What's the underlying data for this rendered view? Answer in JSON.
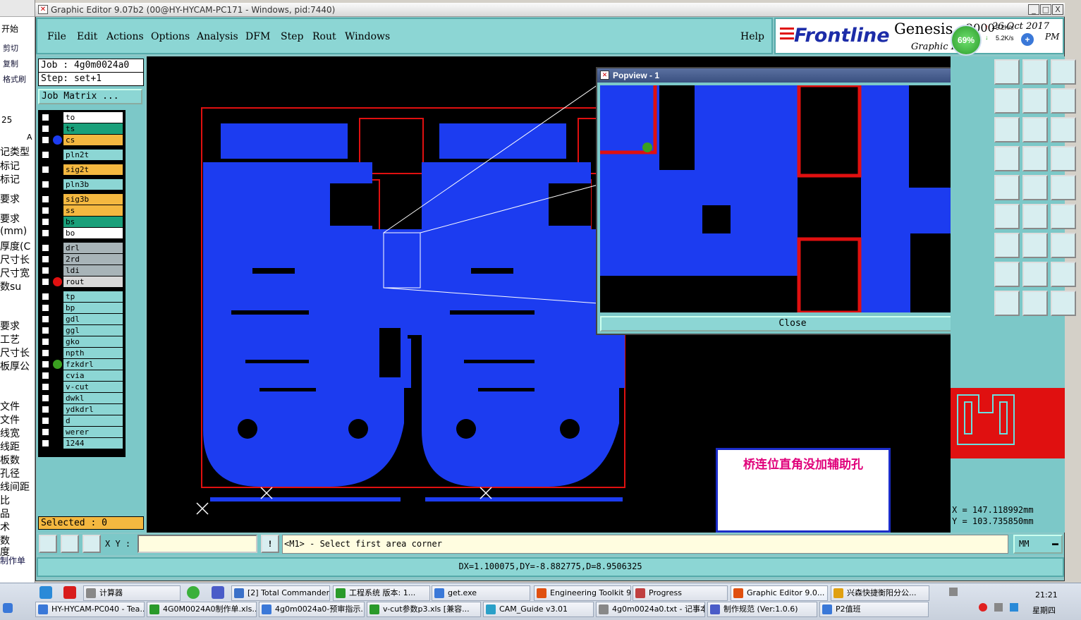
{
  "left_strip": {
    "items": [
      "开始",
      "剪切",
      "复制",
      "格式刷",
      "25",
      "记类型",
      "标记",
      "标记",
      "要求",
      "要求",
      "(mm)",
      "厚度(C",
      "尺寸长",
      "尺寸宽",
      "数su",
      "要求",
      "工艺",
      "尺寸长",
      "板厚公",
      "文件",
      "文件",
      "线宽",
      "线距",
      "板数",
      "孔径",
      "线间距",
      "比",
      "品",
      "术",
      "数",
      "度",
      "制作单"
    ],
    "a_label": "A"
  },
  "window": {
    "title": "Graphic Editor 9.07b2 (00@HY-HYCAM-PC171 - Windows, pid:7440)",
    "min": "_",
    "max": "□",
    "close": "X"
  },
  "menu": {
    "items": [
      "File",
      "Edit",
      "Actions",
      "Options",
      "Analysis",
      "DFM",
      "Step",
      "Rout",
      "Windows"
    ],
    "help": "Help"
  },
  "brand": {
    "logo": "Frontline",
    "product": "Genesis",
    "product_num": "2000",
    "subtitle": "Graphic E",
    "date": "26 Oct 2017",
    "time_suffix": "PM",
    "cpu": "69%",
    "up_speed": "5.2K/s",
    "down_speed": "5.2K/s"
  },
  "job": {
    "job_label": "Job : 4g0m0024a0",
    "step_label": "Step: set+1",
    "matrix_button": "Job Matrix ...",
    "selected": "Selected : 0"
  },
  "layers": [
    {
      "name": "to",
      "color": "#ffffff",
      "dot": ""
    },
    {
      "name": "ts",
      "color": "#1aa07a",
      "dot": ""
    },
    {
      "name": "cs",
      "color": "#f4b840",
      "dot": "#1c3cf0"
    },
    {
      "name": "pln2t",
      "color": "#8cd6d4",
      "dot": ""
    },
    {
      "name": "sig2t",
      "color": "#f4b840",
      "dot": ""
    },
    {
      "name": "pln3b",
      "color": "#8cd6d4",
      "dot": ""
    },
    {
      "name": "sig3b",
      "color": "#f4b840",
      "dot": ""
    },
    {
      "name": "ss",
      "color": "#f4b840",
      "dot": ""
    },
    {
      "name": "bs",
      "color": "#1aa07a",
      "dot": ""
    },
    {
      "name": "bo",
      "color": "#ffffff",
      "dot": ""
    },
    {
      "name": "drl",
      "color": "#a8b4b8",
      "dot": ""
    },
    {
      "name": "2rd",
      "color": "#a8b4b8",
      "dot": ""
    },
    {
      "name": "ldi",
      "color": "#a8b4b8",
      "dot": ""
    },
    {
      "name": "rout",
      "color": "#d8d8d8",
      "dot": "#e01010"
    },
    {
      "name": "tp",
      "color": "#8cd6d4",
      "dot": ""
    },
    {
      "name": "bp",
      "color": "#8cd6d4",
      "dot": ""
    },
    {
      "name": "gdl",
      "color": "#8cd6d4",
      "dot": ""
    },
    {
      "name": "ggl",
      "color": "#8cd6d4",
      "dot": ""
    },
    {
      "name": "gko",
      "color": "#8cd6d4",
      "dot": ""
    },
    {
      "name": "npth",
      "color": "#8cd6d4",
      "dot": ""
    },
    {
      "name": "fzkdrl",
      "color": "#8cd6d4",
      "dot": "#3aa020"
    },
    {
      "name": "cvia",
      "color": "#8cd6d4",
      "dot": ""
    },
    {
      "name": "v-cut",
      "color": "#8cd6d4",
      "dot": ""
    },
    {
      "name": "dwkl",
      "color": "#8cd6d4",
      "dot": ""
    },
    {
      "name": "ydkdrl",
      "color": "#8cd6d4",
      "dot": ""
    },
    {
      "name": "d",
      "color": "#8cd6d4",
      "dot": ""
    },
    {
      "name": "werer",
      "color": "#8cd6d4",
      "dot": ""
    },
    {
      "name": "1244",
      "color": "#8cd6d4",
      "dot": ""
    }
  ],
  "popview": {
    "title": "Popview - 1",
    "close_button": "Close",
    "close_x": "X"
  },
  "note": "桥连位直角没加辅助孔",
  "readout": {
    "x": "X  =  147.118992mm",
    "y": "Y  =  103.735850mm"
  },
  "status": {
    "xy_label": "X Y :",
    "message": "<M1> - Select first area corner",
    "units": "MM",
    "delta": "DX=1.100075,DY=-8.882775,D=8.9506325"
  },
  "taskbar": {
    "row1": [
      "计算器",
      "",
      "[2] Total Commander...",
      "工程系统  版本: 1...",
      "get.exe",
      "Engineering Toolkit 9...",
      "Progress",
      "Graphic Editor 9.0...",
      "兴森快捷衡阳分公..."
    ],
    "row2": [
      "HY-HYCAM-PC040 - Tea...",
      "4G0M0024A0制作单.xls...",
      "4g0m0024a0-预审指示...",
      "v-cut参数p3.xls [兼容...",
      "CAM_Guide v3.01",
      "4g0m0024a0.txt - 记事本",
      "制作规范 (Ver:1.0.6)",
      "P2值班"
    ],
    "clock": "21:21",
    "weekday": "星期四"
  },
  "colors": {
    "panel": "#7cc8c8",
    "copper": "#1c3cf0",
    "rout": "#e01010",
    "note_text": "#e0007a"
  }
}
